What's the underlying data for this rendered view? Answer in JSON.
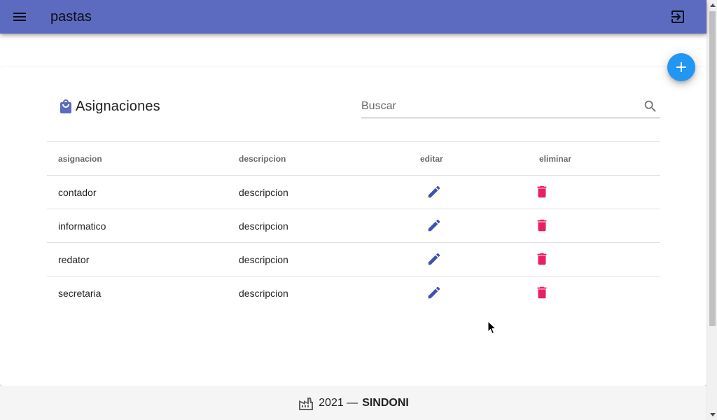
{
  "appbar": {
    "title": "pastas",
    "color": "#5c6bc0"
  },
  "icons": {
    "menu": "menu-icon",
    "logout": "logout-icon",
    "add": "plus-icon",
    "title": "shopping-bag-icon",
    "search": "search-icon",
    "edit": "pencil-icon",
    "delete": "trash-icon",
    "footer": "factory-icon"
  },
  "card": {
    "title": "Asignaciones"
  },
  "search": {
    "placeholder": "Buscar",
    "value": ""
  },
  "table": {
    "headers": {
      "asignacion": "asignacion",
      "descripcion": "descripcion",
      "editar": "editar",
      "eliminar": "eliminar"
    },
    "rows": [
      {
        "asignacion": "contador",
        "descripcion": "descripcion"
      },
      {
        "asignacion": "informatico",
        "descripcion": "descripcion"
      },
      {
        "asignacion": "redator",
        "descripcion": "descripcion"
      },
      {
        "asignacion": "secretaria",
        "descripcion": "descripcion"
      }
    ]
  },
  "footer": {
    "year": "2021 —",
    "brand": "SINDONI"
  },
  "colors": {
    "accent": "#2196f3",
    "edit": "#3f51b5",
    "delete": "#e91e63",
    "title_icon": "#5c6bc0"
  }
}
